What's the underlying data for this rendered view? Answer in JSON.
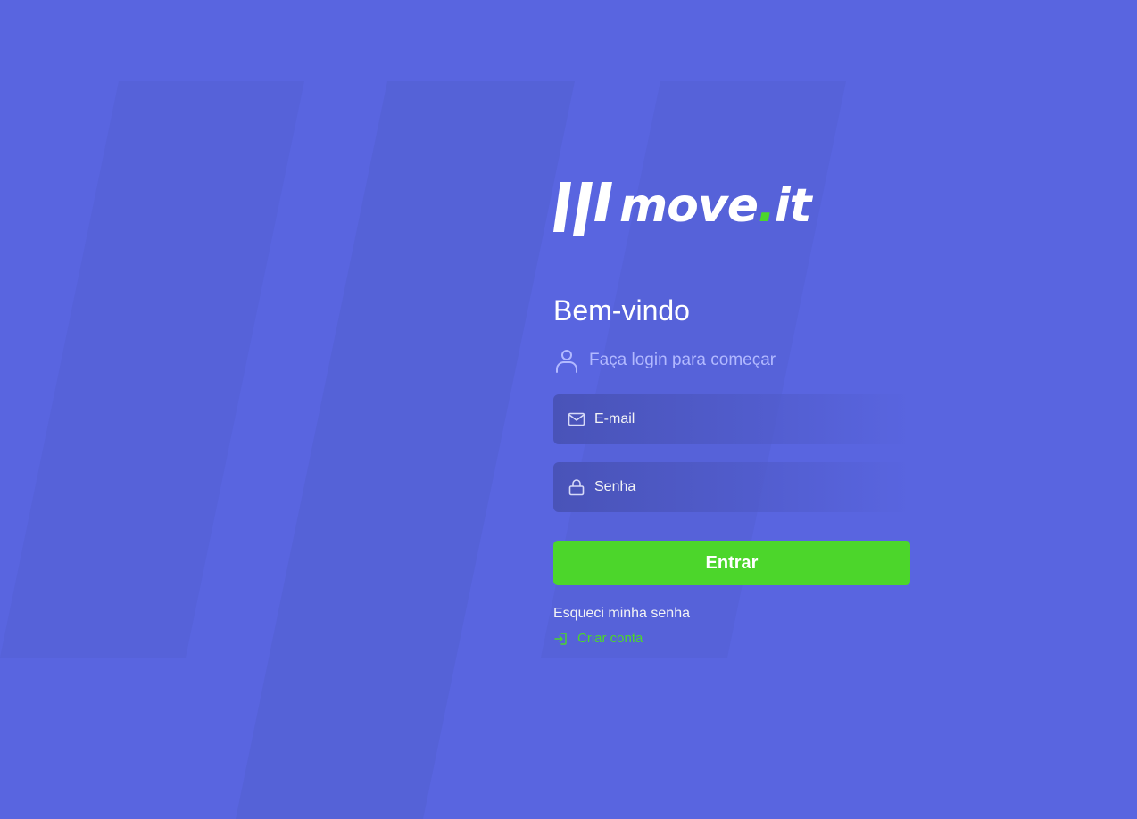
{
  "app": {
    "name": "move.it",
    "colors": {
      "background": "#5965E0",
      "accent": "#4CD62B",
      "text": "#FFFFFF",
      "muted": "#B2B9FF"
    }
  },
  "logo": {
    "text_main": "move",
    "text_dot": ".",
    "text_end": "it",
    "icon": "three-bars-logo-icon"
  },
  "login": {
    "title": "Bem-vindo",
    "subtitle": "Faça login para começar",
    "subtitle_icon": "user-icon",
    "email": {
      "placeholder": "E-mail",
      "value": "",
      "icon": "mail-icon"
    },
    "password": {
      "placeholder": "Senha",
      "value": "",
      "icon": "lock-icon"
    },
    "submit_label": "Entrar",
    "forgot_label": "Esqueci minha senha",
    "create_label": "Criar conta",
    "create_icon": "log-in-icon"
  }
}
